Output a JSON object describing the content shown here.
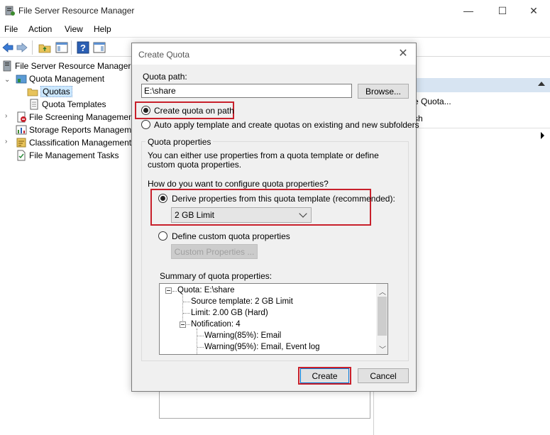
{
  "window": {
    "title": "File Server Resource Manager",
    "min_glyph": "—",
    "max_glyph": "☐",
    "close_glyph": "✕"
  },
  "menu": [
    "File",
    "Action",
    "View",
    "Help"
  ],
  "tree": {
    "root": "File Server Resource Manager (L",
    "quota_management": "Quota Management",
    "quotas": "Quotas",
    "quota_templates": "Quota Templates",
    "file_screening": "File Screening Management",
    "storage_reports": "Storage Reports Manageme",
    "classification": "Classification Management",
    "file_management_tasks": "File Management Tasks"
  },
  "actions": {
    "item1": "e Quota...",
    "item2": "sh"
  },
  "dialog": {
    "title": "Create Quota",
    "quota_path_label": "Quota path:",
    "quota_path_value": "E:\\share",
    "browse_label": "Browse...",
    "radio_create_on_path": "Create quota on path",
    "radio_auto_apply": "Auto apply template and create quotas on existing and new subfolders",
    "group_title": "Quota properties",
    "group_desc": "You can either use properties from a quota template or define custom quota properties.",
    "how_question": "How do you want to configure quota properties?",
    "radio_derive": "Derive properties from this quota template (recommended):",
    "template_selected": "2 GB Limit",
    "radio_custom": "Define custom quota properties",
    "custom_button": "Custom Properties ...",
    "summary_label": "Summary of quota properties:",
    "summary": {
      "root": "Quota: E:\\share",
      "source": "Source template: 2 GB Limit",
      "limit": "Limit: 2.00 GB (Hard)",
      "notification": "Notification: 4",
      "warn85": "Warning(85%): Email",
      "warn95": "Warning(95%): Email, Event log"
    },
    "create_label": "Create",
    "cancel_label": "Cancel"
  },
  "colors": {
    "highlight_red": "#c8202b",
    "selection_blue": "#cce8ff",
    "actions_header": "#d7e4f2"
  }
}
